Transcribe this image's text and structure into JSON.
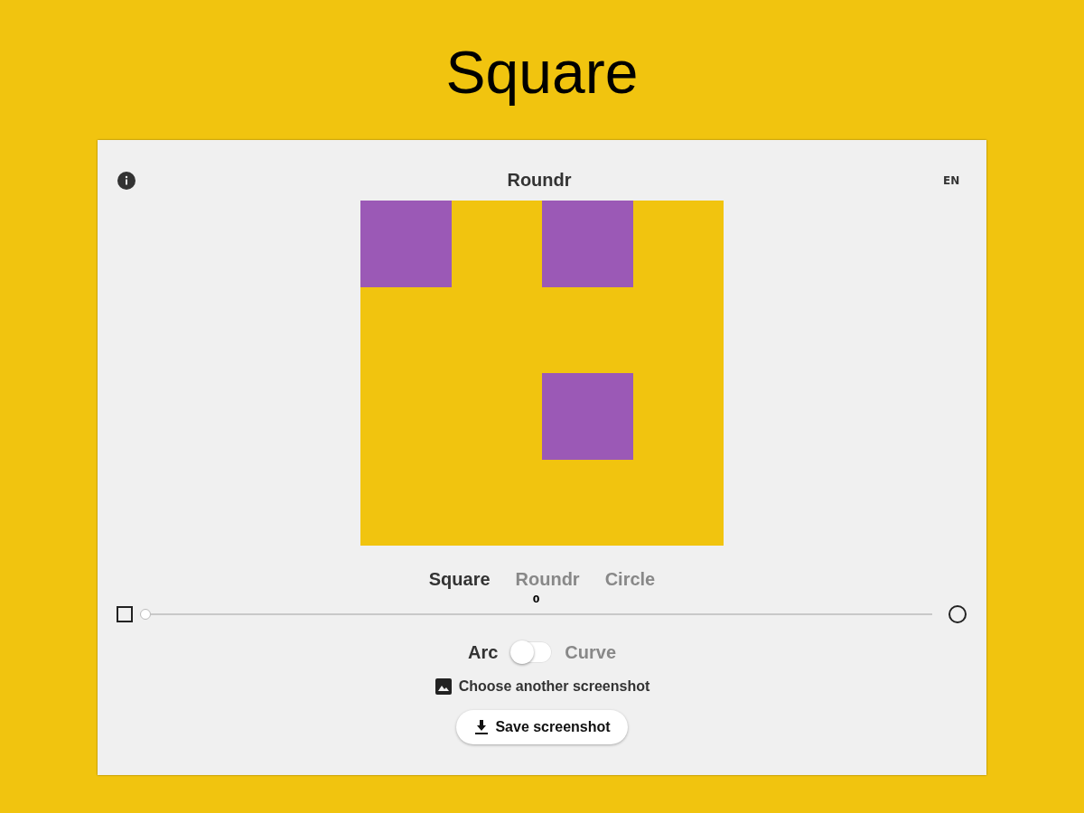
{
  "heading": "Square",
  "app": {
    "title": "Roundr",
    "language": "EN",
    "preview": {
      "rows": [
        [
          {
            "filled": true
          },
          {
            "filled": false
          },
          {
            "filled": true
          },
          {
            "filled": false
          }
        ],
        [
          {
            "filled": false
          },
          {
            "filled": false
          },
          {
            "filled": false
          },
          {
            "filled": false
          }
        ],
        [
          {
            "filled": false
          },
          {
            "filled": false
          },
          {
            "filled": true
          },
          {
            "filled": false
          }
        ],
        [
          {
            "filled": false
          },
          {
            "filled": false
          },
          {
            "filled": false
          },
          {
            "filled": false
          }
        ]
      ]
    },
    "modes": [
      {
        "label": "Square",
        "selected": true
      },
      {
        "label": "Roundr",
        "selected": false
      },
      {
        "label": "Circle",
        "selected": false
      }
    ],
    "slider": {
      "reading": "0",
      "level": 0
    },
    "toggle": {
      "left_label": "Arc",
      "right_label": "Curve",
      "on": false
    },
    "choose_link": "Choose another screenshot",
    "save_button": "Save screenshot"
  }
}
